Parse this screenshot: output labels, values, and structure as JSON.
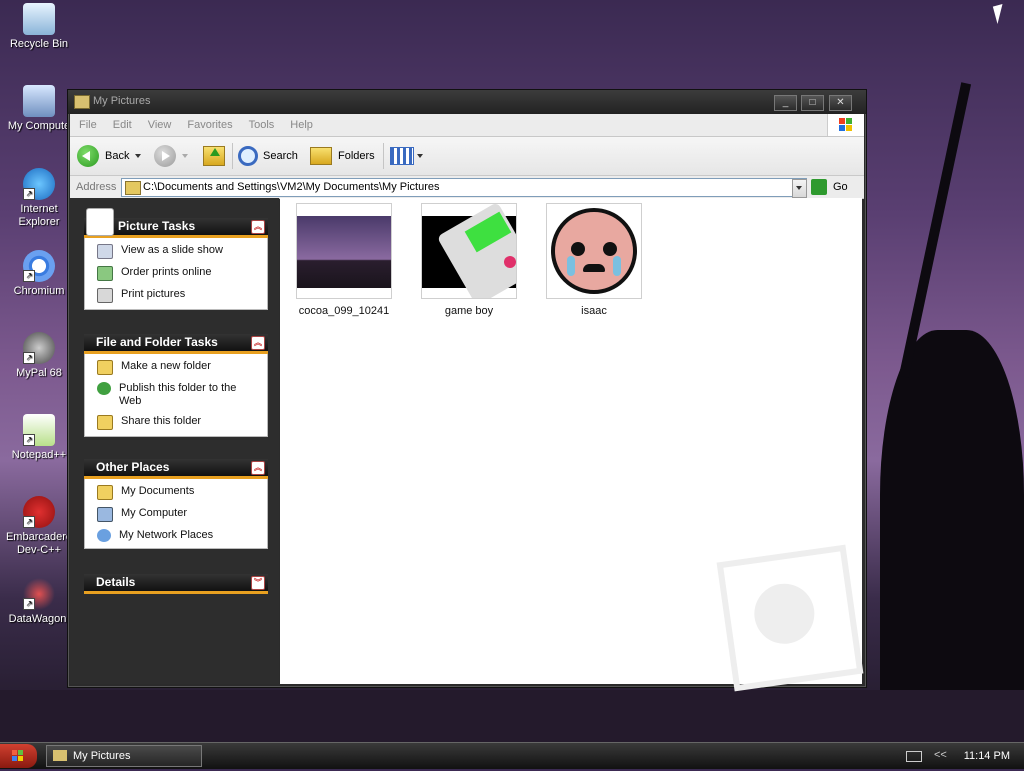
{
  "desktop": {
    "icons": [
      {
        "label": "Recycle Bin",
        "icon": "recycle-bin-icon"
      },
      {
        "label": "My Compute",
        "icon": "my-computer-icon"
      },
      {
        "label": "Internet Explorer",
        "icon": "internet-explorer-icon"
      },
      {
        "label": "Chromium",
        "icon": "chromium-icon"
      },
      {
        "label": "MyPal 68",
        "icon": "mypal-icon"
      },
      {
        "label": "Notepad++",
        "icon": "notepad-plus-plus-icon"
      },
      {
        "label": "Embarcadero Dev-C++",
        "icon": "devcpp-icon"
      },
      {
        "label": "DataWagon.",
        "icon": "datawagon-icon"
      }
    ]
  },
  "window": {
    "title": "My Pictures",
    "menu": [
      "File",
      "Edit",
      "View",
      "Favorites",
      "Tools",
      "Help"
    ],
    "toolbar": {
      "back": "Back",
      "search": "Search",
      "folders": "Folders"
    },
    "address": {
      "label": "Address",
      "value": "C:\\Documents and Settings\\VM2\\My Documents\\My Pictures",
      "go": "Go"
    },
    "task_pane": {
      "picture_tasks": {
        "title": "Picture Tasks",
        "items": [
          "View as a slide show",
          "Order prints online",
          "Print pictures"
        ]
      },
      "file_folder_tasks": {
        "title": "File and Folder Tasks",
        "items": [
          "Make a new folder",
          "Publish this folder to the Web",
          "Share this folder"
        ]
      },
      "other_places": {
        "title": "Other Places",
        "items": [
          "My Documents",
          "My Computer",
          "My Network Places"
        ]
      },
      "details": {
        "title": "Details"
      }
    },
    "files": [
      {
        "name": "cocoa_099_10241"
      },
      {
        "name": "game boy"
      },
      {
        "name": "isaac"
      }
    ]
  },
  "taskbar": {
    "task_label": "My Pictures",
    "tray_chevron": "<<",
    "clock": "11:14 PM"
  },
  "colors": {
    "accent": "#e8a020",
    "pane_bg": "#2d2d2d",
    "titlebar": "#222222"
  }
}
